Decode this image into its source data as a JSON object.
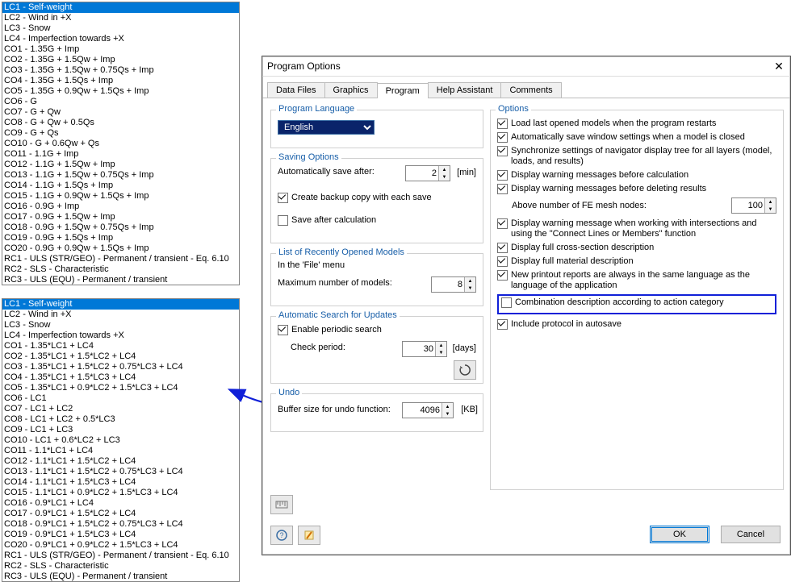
{
  "listA": {
    "items": [
      "LC1 - Self-weight",
      "LC2 - Wind in +X",
      "LC3 - Snow",
      "LC4 - Imperfection towards +X",
      "CO1 - 1.35G + Imp",
      "CO2 - 1.35G + 1.5Qw + Imp",
      "CO3 - 1.35G + 1.5Qw + 0.75Qs + Imp",
      "CO4 - 1.35G + 1.5Qs + Imp",
      "CO5 - 1.35G + 0.9Qw + 1.5Qs + Imp",
      "CO6 - G",
      "CO7 - G + Qw",
      "CO8 - G + Qw + 0.5Qs",
      "CO9 - G + Qs",
      "CO10 - G + 0.6Qw + Qs",
      "CO11 - 1.1G + Imp",
      "CO12 - 1.1G + 1.5Qw + Imp",
      "CO13 - 1.1G + 1.5Qw + 0.75Qs + Imp",
      "CO14 - 1.1G + 1.5Qs + Imp",
      "CO15 - 1.1G + 0.9Qw + 1.5Qs + Imp",
      "CO16 - 0.9G + Imp",
      "CO17 - 0.9G + 1.5Qw + Imp",
      "CO18 - 0.9G + 1.5Qw + 0.75Qs + Imp",
      "CO19 - 0.9G + 1.5Qs + Imp",
      "CO20 - 0.9G + 0.9Qw + 1.5Qs + Imp",
      "RC1 - ULS (STR/GEO) - Permanent / transient - Eq. 6.10",
      "RC2 - SLS - Characteristic",
      "RC3 - ULS (EQU) - Permanent / transient"
    ],
    "selected": 0
  },
  "listB": {
    "items": [
      "LC1 - Self-weight",
      "LC2 - Wind in +X",
      "LC3 - Snow",
      "LC4 - Imperfection towards +X",
      "CO1 - 1.35*LC1 + LC4",
      "CO2 - 1.35*LC1 + 1.5*LC2 + LC4",
      "CO3 - 1.35*LC1 + 1.5*LC2 + 0.75*LC3 + LC4",
      "CO4 - 1.35*LC1 + 1.5*LC3 + LC4",
      "CO5 - 1.35*LC1 + 0.9*LC2 + 1.5*LC3 + LC4",
      "CO6 - LC1",
      "CO7 - LC1 + LC2",
      "CO8 - LC1 + LC2 + 0.5*LC3",
      "CO9 - LC1 + LC3",
      "CO10 - LC1 + 0.6*LC2 + LC3",
      "CO11 - 1.1*LC1 + LC4",
      "CO12 - 1.1*LC1 + 1.5*LC2 + LC4",
      "CO13 - 1.1*LC1 + 1.5*LC2 + 0.75*LC3 + LC4",
      "CO14 - 1.1*LC1 + 1.5*LC3 + LC4",
      "CO15 - 1.1*LC1 + 0.9*LC2 + 1.5*LC3 + LC4",
      "CO16 - 0.9*LC1 + LC4",
      "CO17 - 0.9*LC1 + 1.5*LC2 + LC4",
      "CO18 - 0.9*LC1 + 1.5*LC2 + 0.75*LC3 + LC4",
      "CO19 - 0.9*LC1 + 1.5*LC3 + LC4",
      "CO20 - 0.9*LC1 + 0.9*LC2 + 1.5*LC3 + LC4",
      "RC1 - ULS (STR/GEO) - Permanent / transient - Eq. 6.10",
      "RC2 - SLS - Characteristic",
      "RC3 - ULS (EQU) - Permanent / transient"
    ],
    "selected": 0
  },
  "dialog": {
    "title": "Program Options",
    "tabs": [
      "Data Files",
      "Graphics",
      "Program",
      "Help Assistant",
      "Comments"
    ],
    "activeTab": 2,
    "groups": {
      "lang": {
        "cap": "Program Language",
        "value": "English"
      },
      "saving": {
        "cap": "Saving Options",
        "auto_label": "Automatically save after:",
        "auto_val": "2",
        "auto_unit": "[min]",
        "backup": {
          "label": "Create backup copy with each save",
          "checked": true
        },
        "after": {
          "label": "Save after calculation",
          "checked": false
        }
      },
      "recent": {
        "cap": "List of Recently Opened Models",
        "hint": "In the 'File' menu",
        "max_label": "Maximum number of models:",
        "max_val": "8"
      },
      "updates": {
        "cap": "Automatic Search for Updates",
        "enable": {
          "label": "Enable periodic search",
          "checked": true
        },
        "period_label": "Check period:",
        "period_val": "30",
        "period_unit": "[days]"
      },
      "undo": {
        "cap": "Undo",
        "buf_label": "Buffer size for undo function:",
        "buf_val": "4096",
        "buf_unit": "[KB]"
      },
      "options": {
        "cap": "Options",
        "items": [
          {
            "label": "Load last opened models when the program restarts",
            "checked": true
          },
          {
            "label": "Automatically save window settings when a model is closed",
            "checked": true
          },
          {
            "label": "Synchronize settings of navigator display tree for all layers (model, loads, and results)",
            "checked": true
          },
          {
            "label": "Display warning messages before calculation",
            "checked": true
          },
          {
            "label": "Display warning messages before deleting results",
            "checked": true
          }
        ],
        "nodes_label": "Above number of FE mesh nodes:",
        "nodes_val": "100",
        "items2": [
          {
            "label": "Display warning message when working with intersections and using the \"Connect Lines or Members\" function",
            "checked": true
          },
          {
            "label": "Display full cross-section description",
            "checked": true
          },
          {
            "label": "Display full material description",
            "checked": true
          },
          {
            "label": "New printout reports are always in the same language as the language of the application",
            "checked": true
          }
        ],
        "combo_desc": {
          "label": "Combination description according to action category",
          "checked": false
        },
        "autosave_protocol": {
          "label": "Include protocol in autosave",
          "checked": true
        }
      }
    },
    "buttons": {
      "ok": "OK",
      "cancel": "Cancel"
    }
  }
}
